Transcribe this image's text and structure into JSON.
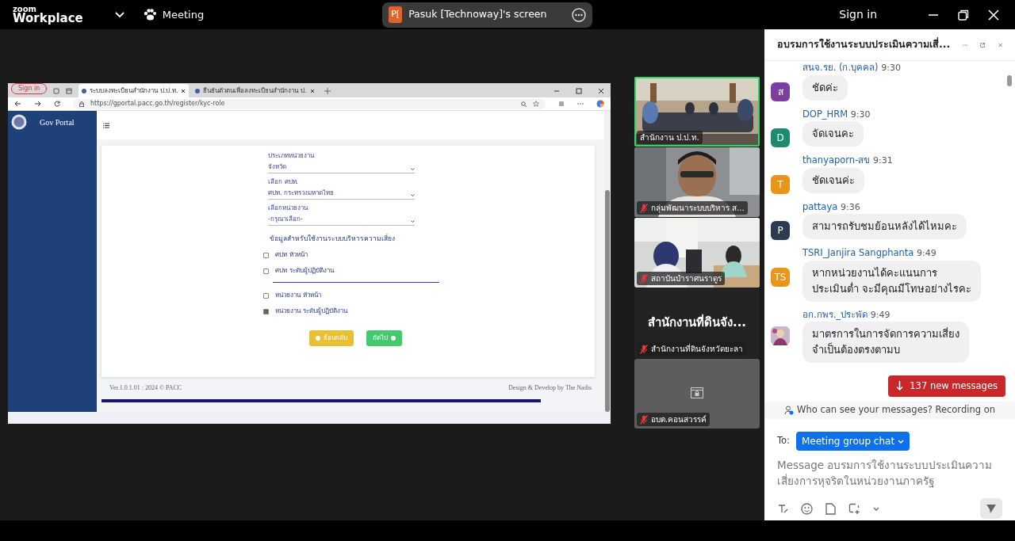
{
  "app": {
    "logo_top": "zoom",
    "logo_bottom": "Workplace",
    "meeting": "Meeting",
    "share_initial": "P[",
    "share_label": "Pasuk [Technoway]'s screen",
    "sign_in": "Sign in"
  },
  "shared_screen": {
    "browser": {
      "profile": "Sign in",
      "tabs": [
        {
          "title": "ระบบลงทะเบียนสำนักงาน ป.ป.ท.",
          "selected": true
        },
        {
          "title": "ยืนยันตัวตนเพื่อลงทะเบียนสำนักงาน ป.",
          "selected": false
        }
      ],
      "url": "https://gportal.pacc.go.th/register/kyc-role"
    },
    "portal": {
      "title": "Gov Portal",
      "fields": [
        {
          "label": "ประเภทหน่วยงาน",
          "value": "จังหวัด"
        },
        {
          "label": "เลือก ศปท.",
          "value": "ศปท. กระทรวงมหาดไทย"
        },
        {
          "label": "เลือกหน่วยงาน",
          "value": "-กรุณาเลือก-"
        }
      ],
      "section": "ข้อมูลสำหรับใช้งานระบบบริหารความเสี่ยง",
      "roles": [
        {
          "label": "ศปท หัวหน้า",
          "checked": false
        },
        {
          "label": "ศปท ระดับผู้ปฏิบัติงาน",
          "checked": false
        },
        {
          "label": "หน่วยงาน หัวหน้า",
          "checked": false
        },
        {
          "label": "หน่วยงาน ระดับผู้ปฏิบัติงาน",
          "checked": true
        }
      ],
      "buttons": [
        {
          "label": "ย้อนกลับ",
          "kind": "back"
        },
        {
          "label": "ถัดไป",
          "kind": "next"
        }
      ],
      "footer_left": "Ver.1.0.1.01 : 2024 © PACC",
      "footer_right": "Design & Develop by The Nadis"
    }
  },
  "participants": [
    {
      "name": "สำนักงาน ป.ป.ท.",
      "kind": "room",
      "muted": false,
      "speaking": true
    },
    {
      "name": "กลุ่มพัฒนาระบบบริหาร ส...",
      "kind": "person",
      "muted": true,
      "speaking": false
    },
    {
      "name": "สถาบันบำราศนราดูร",
      "kind": "office",
      "muted": true,
      "speaking": false
    },
    {
      "name": "สำนักงานที่ดินจังหวัดยะลา",
      "display": "สำนักงานที่ดินจัง...",
      "kind": "name_only",
      "muted": true,
      "speaking": false
    },
    {
      "name": "อบต.คอนสวรรค์",
      "kind": "locked",
      "muted": true,
      "speaking": false
    }
  ],
  "chat": {
    "title": "อบรมการใช้งานระบบประเมินความเสี่...",
    "messages": [
      {
        "sender": "สนจ.รย. (ก.บุคคล)",
        "time": "9:30",
        "initials": "ส",
        "color": "#7b3fa0",
        "lines": [
          "ชัดค่ะ"
        ]
      },
      {
        "sender": "DOP_HRM",
        "time": "9:30",
        "initials": "D",
        "color": "#1f8a70",
        "lines": [
          "จัดเจนคะ"
        ]
      },
      {
        "sender": "thanyaporn-สข",
        "time": "9:31",
        "initials": "T",
        "color": "#e8951a",
        "lines": [
          "ชัดเจนค่ะ"
        ]
      },
      {
        "sender": "pattaya",
        "time": "9:36",
        "initials": "P",
        "color": "#2b3c52",
        "lines": [
          "สามารถรับชมย้อนหลังได้ไหมคะ"
        ]
      },
      {
        "sender": "TSRI_Janjira Sangphanta",
        "time": "9:49",
        "initials": "TS",
        "color": "#e8951a",
        "lines": [
          "หากหน่วยงานได้คะแนนการ",
          "ประเมินต่ำ จะมีคุณมีโทษอย่างไรคะ"
        ]
      },
      {
        "sender": "อก.กพร._ประพัด",
        "time": "9:49",
        "kind": "picture",
        "lines": [
          "มาตรการในการจัดการความเสี่ยง",
          "จำเป็นต้องตรงตามบ"
        ]
      }
    ],
    "new_messages": "137 new messages",
    "privacy": "Who can see your messages? Recording on",
    "to_label": "To:",
    "recipient": "Meeting group chat",
    "placeholder": "Message อบรมการใช้งานระบบประเมินความเสี่ยงการหุจริตในหน่วยงานภาครัฐ"
  }
}
